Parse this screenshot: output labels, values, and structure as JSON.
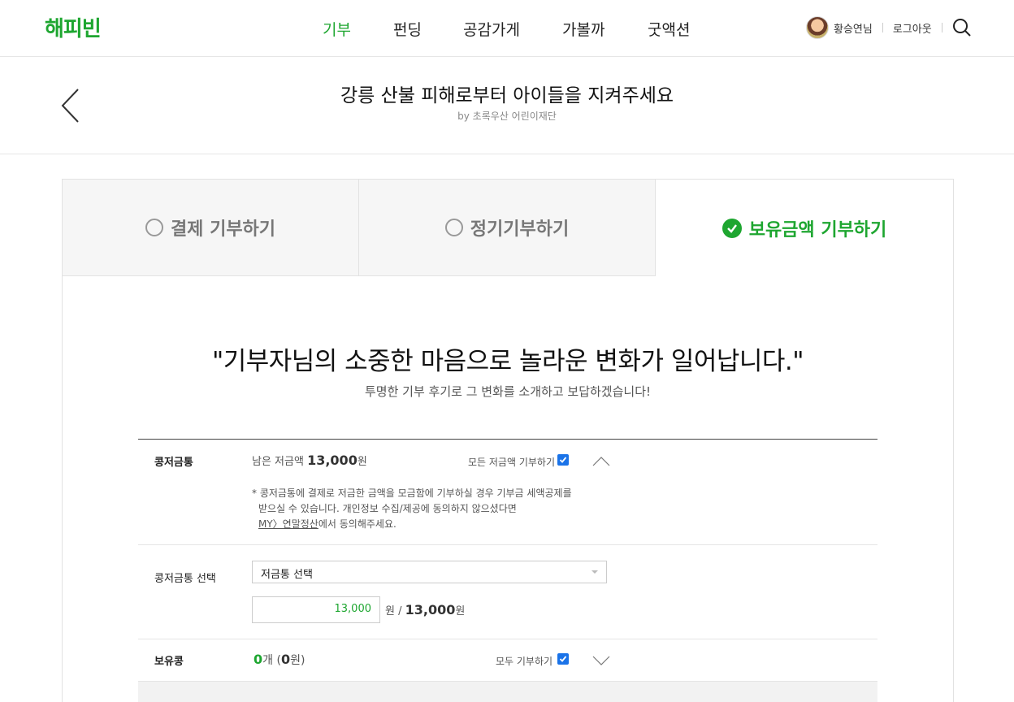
{
  "header": {
    "logo": "해피빈",
    "nav": [
      "기부",
      "펀딩",
      "공감가게",
      "가볼까",
      "굿액션"
    ],
    "active_nav": "기부",
    "user_name": "황승연님",
    "logout": "로그아웃",
    "accent_color": "#1ea630"
  },
  "title": {
    "main": "강릉 산불 피해로부터 아이들을 지켜주세요",
    "by": "by 초록우산 어린이재단"
  },
  "tabs": [
    {
      "label": "결제 기부하기",
      "selected": false
    },
    {
      "label": "정기기부하기",
      "selected": false
    },
    {
      "label": "보유금액 기부하기",
      "selected": true
    }
  ],
  "quote": {
    "main": "\"기부자님의 소중한 마음으로 놀라운 변화가 일어납니다.\"",
    "sub": "투명한 기부 후기로 그 변화를 소개하고 보답하겠습니다!"
  },
  "piggy": {
    "label": "콩저금통",
    "remaining_prefix": "남은 저금액",
    "remaining_amount": "13,000",
    "remaining_unit": "원",
    "donate_all": "모든 저금액 기부하기",
    "donate_all_checked": true,
    "note_line1": "* 콩저금통에 결제로 저금한 금액을 모금함에 기부하실 경우 기부금 세액공제를",
    "note_line2": "받으실 수 있습니다. 개인정보 수집/제공에 동의하지 않으셨다면",
    "note_link": "MY〉연말정산",
    "note_line3_suffix": "에서 동의해주세요."
  },
  "piggy_select": {
    "label": "콩저금통 선택",
    "select_value": "저금통 선택",
    "input_value": "13,000",
    "unit_sep": "원 /",
    "total": "13,000",
    "total_unit": "원"
  },
  "beans": {
    "label": "보유콩",
    "count": "0",
    "count_unit": "개 (",
    "won": "0",
    "won_unit": "원)",
    "donate_all": "모두 기부하기",
    "donate_all_checked": true
  }
}
